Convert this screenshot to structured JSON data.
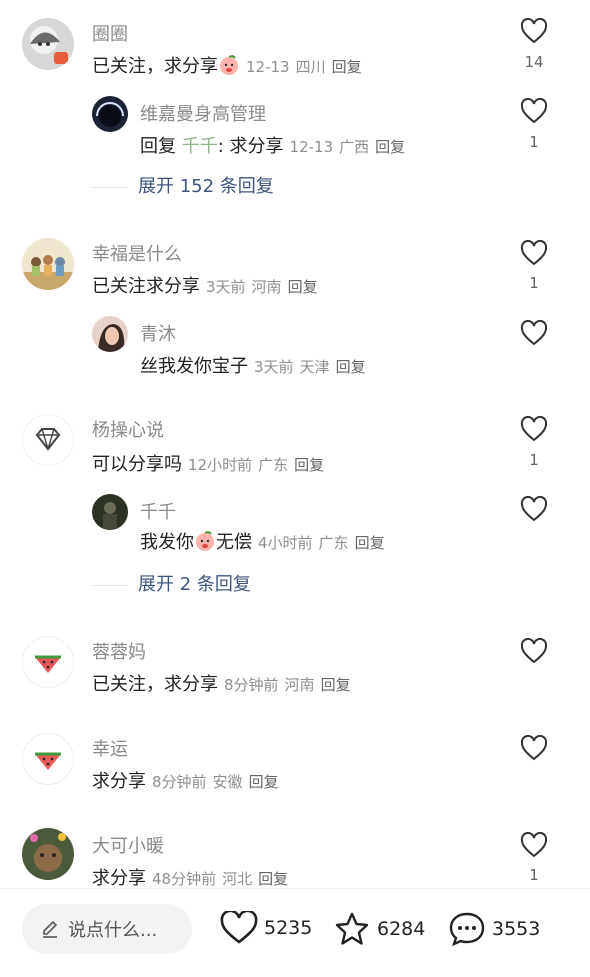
{
  "comments": [
    {
      "user": "圈圈",
      "text": "已关注，求分享",
      "emoji": "peach-emoji",
      "time": "12-13",
      "location": "四川",
      "reply": "回复",
      "likes": "14"
    },
    {
      "user": "维嘉曼身高管理",
      "prefix": "回复",
      "mention": "千千",
      "text": ": 求分享",
      "time": "12-13",
      "location": "广西",
      "reply": "回复",
      "likes": "1"
    },
    {
      "user": "幸福是什么",
      "text": "已关注求分享",
      "time": "3天前",
      "location": "河南",
      "reply": "回复",
      "likes": "1"
    },
    {
      "user": "青沐",
      "text": "丝我发你宝子",
      "time": "3天前",
      "location": "天津",
      "reply": "回复",
      "likes": ""
    },
    {
      "user": "杨操心说",
      "text": "可以分享吗",
      "time": "12小时前",
      "location": "广东",
      "reply": "回复",
      "likes": "1"
    },
    {
      "user": "千千",
      "text_a": "我发你",
      "emoji": "peach-emoji",
      "text_b": "无偿",
      "time": "4小时前",
      "location": "广东",
      "reply": "回复",
      "likes": ""
    },
    {
      "user": "蓉蓉妈",
      "text": "已关注，求分享",
      "time": "8分钟前",
      "location": "河南",
      "reply": "回复",
      "likes": ""
    },
    {
      "user": "幸运",
      "text": "求分享",
      "time": "8分钟前",
      "location": "安徽",
      "reply": "回复",
      "likes": ""
    },
    {
      "user": "大可小暖",
      "text": "求分享",
      "time": "48分钟前",
      "location": "河北",
      "reply": "回复",
      "likes": "1"
    }
  ],
  "expand": [
    "展开 152 条回复",
    "展开 2 条回复"
  ],
  "bottom": {
    "placeholder": "说点什么...",
    "likes": "5235",
    "favorites": "6284",
    "comments": "3553"
  },
  "colors": {
    "mention": "#8fb488",
    "expand": "#3d5580",
    "meta": "#8f8f8f"
  }
}
